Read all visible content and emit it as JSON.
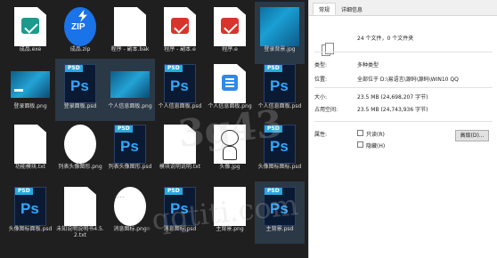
{
  "files": [
    {
      "name": "成品.exe",
      "icon": "teal-check-file-icon"
    },
    {
      "name": "成品.zip",
      "icon": "zip-archive-icon"
    },
    {
      "name": "程序 - 副本.bak",
      "icon": "blank-document-icon"
    },
    {
      "name": "程序 - 副本.e",
      "icon": "red-check-file-icon"
    },
    {
      "name": "程序.e",
      "icon": "red-check-file-icon"
    },
    {
      "name": "登录背景.jpg",
      "icon": "blue-image-thumbnail-icon"
    },
    {
      "name": "登录面板.png",
      "icon": "blue-image-thumbnail-icon"
    },
    {
      "name": "登录面板.psd",
      "icon": "photoshop-file-icon"
    },
    {
      "name": "个人信息面板.png",
      "icon": "blue-image-thumbnail-icon"
    },
    {
      "name": "个人信息面板.psd",
      "icon": "photoshop-file-icon"
    },
    {
      "name": "个人信息面板.png",
      "icon": "list-document-icon"
    },
    {
      "name": "个人信息面板.psd",
      "icon": "photoshop-file-icon"
    },
    {
      "name": "功能模块.txt",
      "icon": "blank-document-icon"
    },
    {
      "name": "列表头像图形.png",
      "icon": "white-circle-icon"
    },
    {
      "name": "列表头像图形.psd",
      "icon": "photoshop-file-icon"
    },
    {
      "name": "模块说明说明.txt",
      "icon": "blank-document-icon"
    },
    {
      "name": "头像.jpg",
      "icon": "sketch-avatar-icon"
    },
    {
      "name": "头像图标图标.psd",
      "icon": "photoshop-file-icon"
    },
    {
      "name": "头像图标面板.psd",
      "icon": "photoshop-file-icon"
    },
    {
      "name": "未知说明说明书4.5.2.txt",
      "icon": "blank-document-icon"
    },
    {
      "name": "消息图标.png",
      "icon": "chat-bubble-icon"
    },
    {
      "name": "消息图标.psd",
      "icon": "photoshop-file-icon"
    },
    {
      "name": "主背景.png",
      "icon": "white-bar-icon"
    },
    {
      "name": "主背景.psd",
      "icon": "photoshop-file-icon"
    }
  ],
  "properties": {
    "tabs": [
      "常规",
      "详细信息"
    ],
    "summary": "24 个文件，0 个文件夹",
    "type_label": "类型:",
    "type_value": "多种类型",
    "location_label": "位置:",
    "location_value": "全部位于 D:\\易语言\\源码\\源码\\WIN10 QQ",
    "size_label": "大小:",
    "size_value": "23.5 MB (24,698,207 字节)",
    "disk_label": "占用空间:",
    "disk_value": "23.5 MB (24,743,936 字节)",
    "attr_label": "属性:",
    "readonly_label": "只读(R)",
    "hidden_label": "隐藏(H)",
    "advanced_button": "高级(D)..."
  },
  "ps_badge": "PSD",
  "ps_glyph": "Ps",
  "zip_glyph": "ZIP",
  "chat_glyph": "···",
  "watermark_text": "3g43",
  "watermark_text2": ".qqtiti.com"
}
